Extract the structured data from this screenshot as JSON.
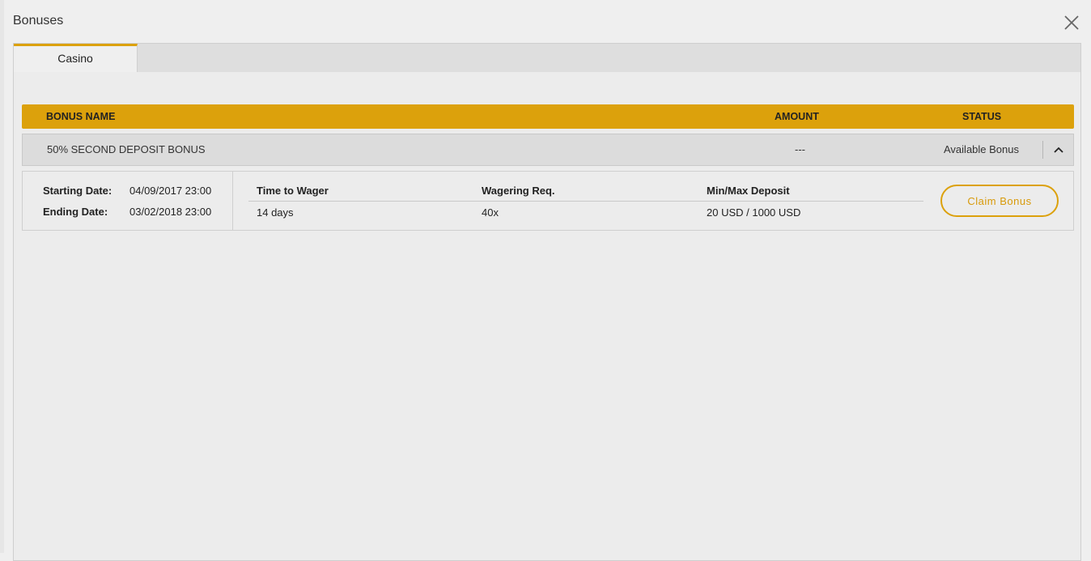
{
  "window": {
    "title": "Bonuses",
    "close_icon": "close-icon"
  },
  "tabs": [
    {
      "label": "Casino",
      "active": true
    }
  ],
  "table": {
    "headers": {
      "bonus_name": "BONUS NAME",
      "amount": "AMOUNT",
      "status": "STATUS"
    },
    "rows": [
      {
        "bonus_name": "50% SECOND DEPOSIT BONUS",
        "amount": "---",
        "status": "Available Bonus",
        "expanded": true,
        "toggle_icon": "chevron-up-icon",
        "details": {
          "starting_date_label": "Starting Date:",
          "starting_date": "04/09/2017 23:00",
          "ending_date_label": "Ending Date:",
          "ending_date": "03/02/2018 23:00",
          "time_to_wager_label": "Time to Wager",
          "time_to_wager": "14 days",
          "wagering_req_label": "Wagering Req.",
          "wagering_req": "40x",
          "min_max_deposit_label": "Min/Max Deposit",
          "min_max_deposit": "20 USD / 1000 USD",
          "claim_label": "Claim Bonus"
        }
      }
    ]
  },
  "colors": {
    "accent": "#dca10c",
    "background": "#efefef",
    "row_background": "#dcdcdc"
  }
}
